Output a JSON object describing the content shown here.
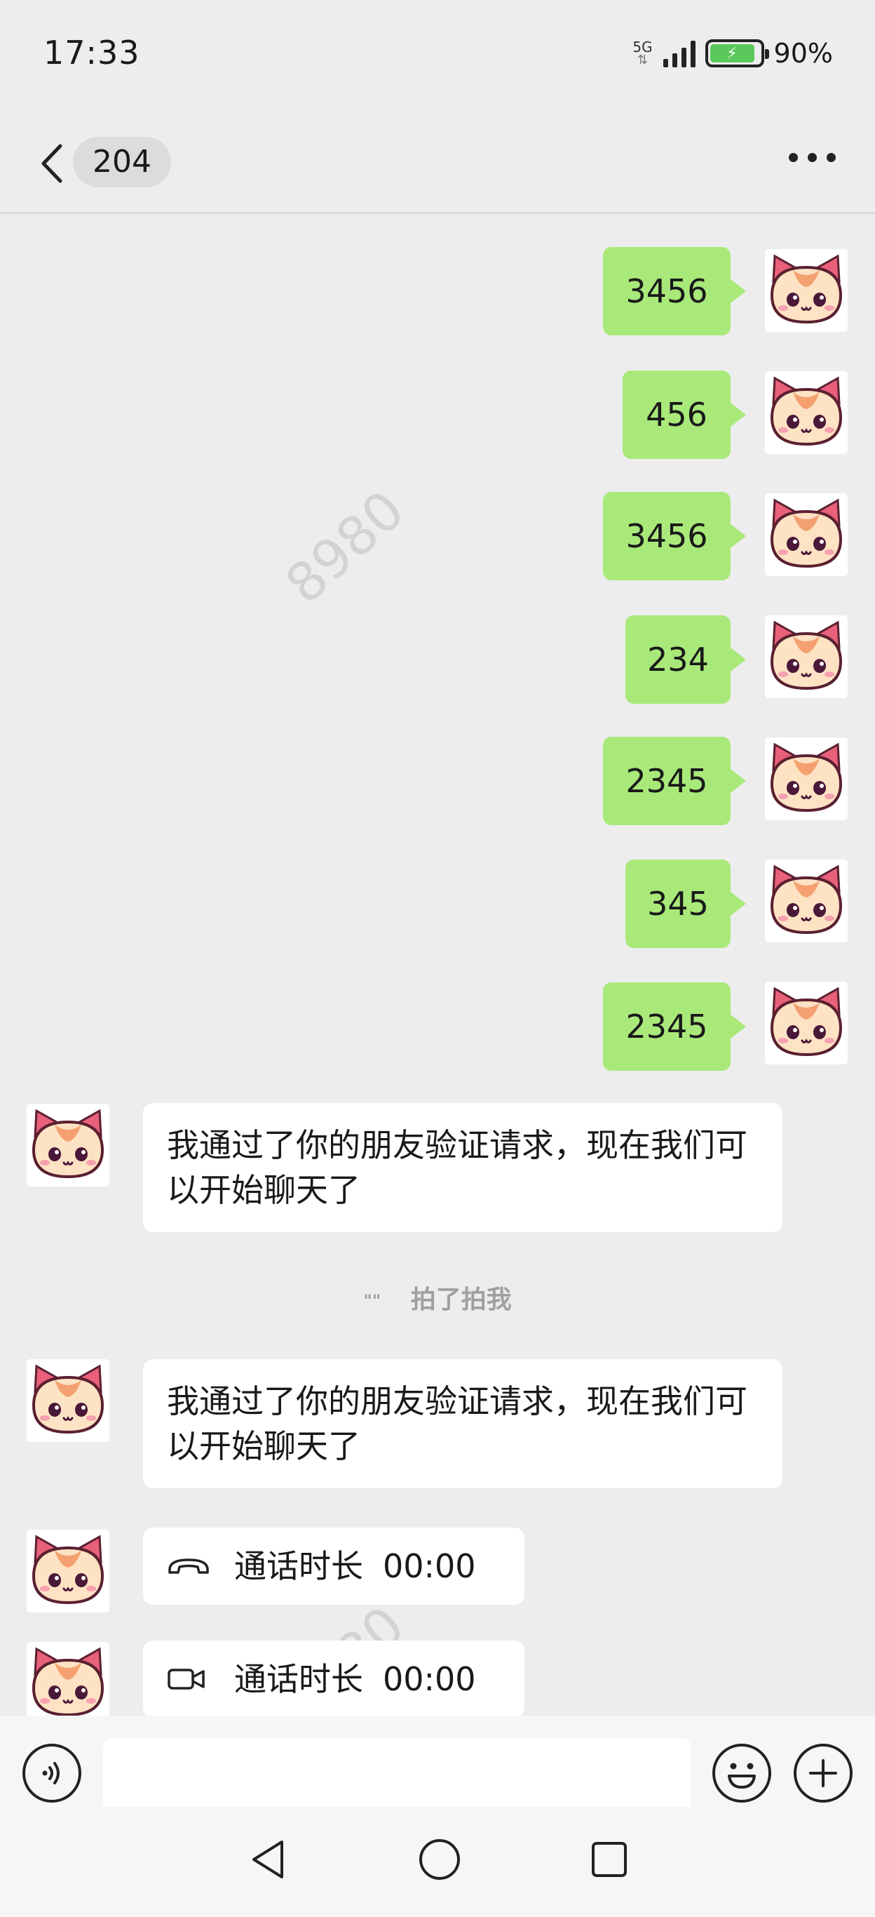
{
  "status_bar": {
    "time": "17:33",
    "network": "5G",
    "battery_percent": "90%",
    "battery_level": 0.9
  },
  "header": {
    "title": "204",
    "back_icon": "chevron-left-icon",
    "more_icon": "more-dots-icon"
  },
  "watermark": "8980",
  "messages_out": [
    {
      "text": "3456"
    },
    {
      "text": "456"
    },
    {
      "text": "3456"
    },
    {
      "text": "234"
    },
    {
      "text": "2345"
    },
    {
      "text": "345"
    },
    {
      "text": "2345"
    }
  ],
  "messages_in": [
    {
      "text": "我通过了你的朋友验证请求，现在我们可以开始聊天了"
    },
    {
      "text": "我通过了你的朋友验证请求，现在我们可以开始聊天了"
    }
  ],
  "system_message": {
    "prefix": "\"\"",
    "text": "拍了拍我"
  },
  "calls": [
    {
      "icon": "phone-handset-icon",
      "label": "通话时长",
      "duration": "00:00"
    },
    {
      "icon": "video-camera-icon",
      "label": "通话时长",
      "duration": "00:00"
    }
  ],
  "input_bar": {
    "voice_icon": "voice-icon",
    "emoji_icon": "emoji-icon",
    "plus_icon": "plus-icon",
    "input_value": ""
  },
  "nav_bar": {
    "back_icon": "triangle-back-icon",
    "home_icon": "circle-home-icon",
    "recent_icon": "square-recent-icon"
  },
  "colors": {
    "background": "#ededed",
    "outgoing_bubble": "#a9e97a",
    "incoming_bubble": "#ffffff",
    "battery_fill": "#5ac85a"
  }
}
